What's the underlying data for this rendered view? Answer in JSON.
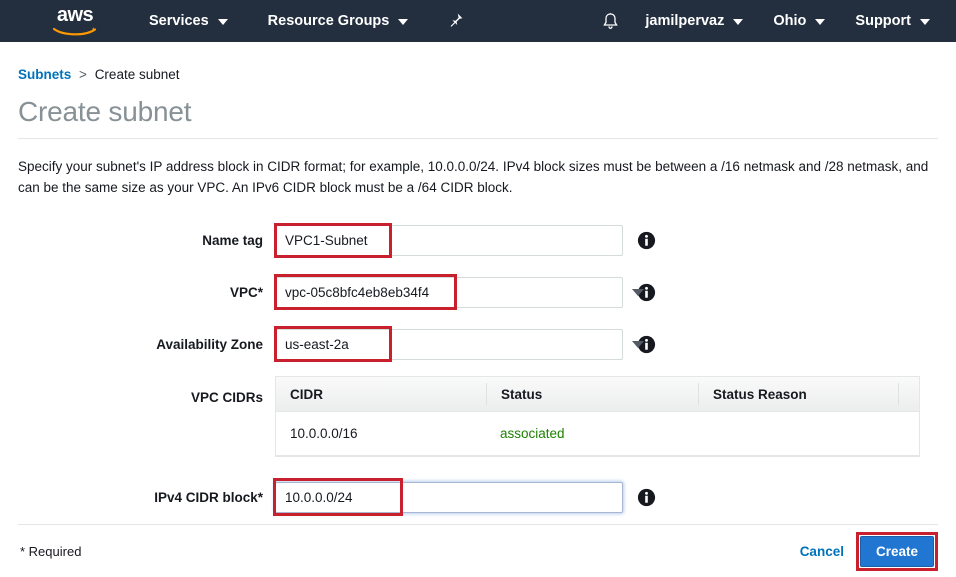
{
  "navbar": {
    "logo_alt": "aws",
    "services_label": "Services",
    "resource_groups_label": "Resource Groups",
    "pin_icon": "pin-icon",
    "bell_icon": "bell-icon",
    "account_label": "jamilpervaz",
    "region_label": "Ohio",
    "support_label": "Support",
    "background_color": "#232f3e",
    "logo_accent_color": "#ff9900"
  },
  "breadcrumb": {
    "parent": "Subnets",
    "separator": ">",
    "current": "Create subnet",
    "link_color": "#0073bb"
  },
  "page": {
    "title": "Create subnet",
    "description": "Specify your subnet's IP address block in CIDR format; for example, 10.0.0.0/24. IPv4 block sizes must be between a /16 netmask and /28 netmask, and can be the same size as your VPC. An IPv6 CIDR block must be a /64 CIDR block."
  },
  "form": {
    "name_tag": {
      "label": "Name tag",
      "value": "VPC1-Subnet",
      "placeholder": "",
      "info_icon": "info-icon"
    },
    "vpc": {
      "label": "VPC*",
      "value": "vpc-05c8bfc4eb8eb34f4",
      "info_icon": "info-icon",
      "caret_icon": "chevron-down-icon"
    },
    "availability_zone": {
      "label": "Availability Zone",
      "value": "us-east-2a",
      "info_icon": "info-icon",
      "caret_icon": "chevron-down-icon"
    },
    "vpc_cidrs": {
      "label": "VPC CIDRs",
      "columns": [
        "CIDR",
        "Status",
        "Status Reason"
      ],
      "rows": [
        {
          "cidr": "10.0.0.0/16",
          "status": "associated",
          "status_reason": ""
        }
      ],
      "status_color": "#1d8102"
    },
    "ipv4_cidr_block": {
      "label": "IPv4 CIDR block*",
      "value": "10.0.0.0/24",
      "info_icon": "info-icon",
      "focused": true
    }
  },
  "footer": {
    "required_note": "* Required",
    "cancel_label": "Cancel",
    "create_label": "Create",
    "create_button_color": "#2176d2",
    "cancel_color": "#0073bb"
  },
  "annotations": {
    "highlight_color": "#c8202d"
  }
}
